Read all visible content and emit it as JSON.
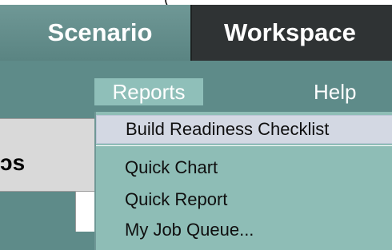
{
  "top_fragment": "(",
  "tabs": {
    "scenario": "Scenario",
    "workspace": "Workspace"
  },
  "menubar": {
    "reports": "Reports",
    "help": "Help"
  },
  "left_panel_fragment": "ɔs",
  "dropdown": {
    "items": [
      "Build Readiness Checklist",
      "Quick Chart",
      "Quick Report",
      "My Job Queue..."
    ]
  }
}
